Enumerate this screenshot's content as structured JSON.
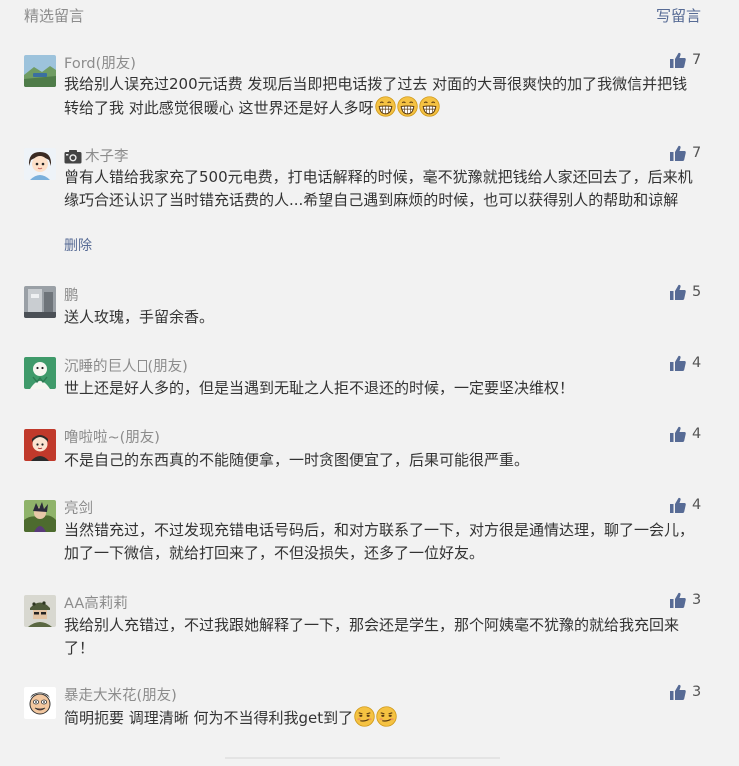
{
  "header": {
    "title": "精选留言",
    "write_label": "写留言"
  },
  "comments": [
    {
      "nick": "Ford(朋友)",
      "content": "我给别人误充过200元话费 发现后当即把电话拨了过去 对面的大哥很爽快的加了我微信并把钱转给了我 对此感觉很暖心 这世界还是好人多呀",
      "emoji_count": 3,
      "emoji": "grin-emoji",
      "likes": "7",
      "avatar": "landscape-avatar"
    },
    {
      "nick": "木子李",
      "nick_icon": "camera-icon",
      "content": "曾有人错给我家充了500元电费，打电话解释的时候，毫不犹豫就把钱给人家还回去了，后来机缘巧合还认识了当时错充话费的人...希望自己遇到麻烦的时候，也可以获得别人的帮助和谅解",
      "delete_label": "删除",
      "likes": "7",
      "avatar": "cartoon-girl-avatar"
    },
    {
      "nick": "鹏",
      "content": "送人玫瑰，手留余香。",
      "likes": "5",
      "avatar": "gray-photo-avatar"
    },
    {
      "nick_prefix": "沉睡的巨人",
      "nick_suffix": "(朋友)",
      "content": "世上还是好人多的，但是当遇到无耻之人拒不退还的时候，一定要坚决维权！",
      "likes": "4",
      "avatar": "green-cartoon-avatar"
    },
    {
      "nick": "噜啦啦~(朋友)",
      "content": "不是自己的东西真的不能随便拿，一时贪图便宜了，后果可能很严重。",
      "likes": "4",
      "avatar": "red-cartoon-avatar"
    },
    {
      "nick": "亮剑",
      "content": "当然错充过，不过发现充错电话号码后，和对方联系了一下，对方很是通情达理，聊了一会儿，加了一下微信，就给打回来了，不但没损失，还多了一位好友。",
      "likes": "4",
      "avatar": "anime-warrior-avatar"
    },
    {
      "nick": "AA高莉莉",
      "content": "我给别人充错过，不过我跟她解释了一下，那会还是学生，那个阿姨毫不犹豫的就给我充回来了！",
      "likes": "3",
      "avatar": "soldier-avatar"
    },
    {
      "nick": "暴走大米花(朋友)",
      "content": "简明扼要 调理清晰 何为不当得利我get到了",
      "emoji_count": 2,
      "emoji": "smirk-emoji",
      "likes": "3",
      "avatar": "rage-face-avatar"
    }
  ],
  "colors": {
    "background": "#f2f2f2",
    "nick": "#8c8c8c",
    "link": "#576b95",
    "like_icon": "#576b95",
    "emoji_yellow": "#f5c242"
  }
}
